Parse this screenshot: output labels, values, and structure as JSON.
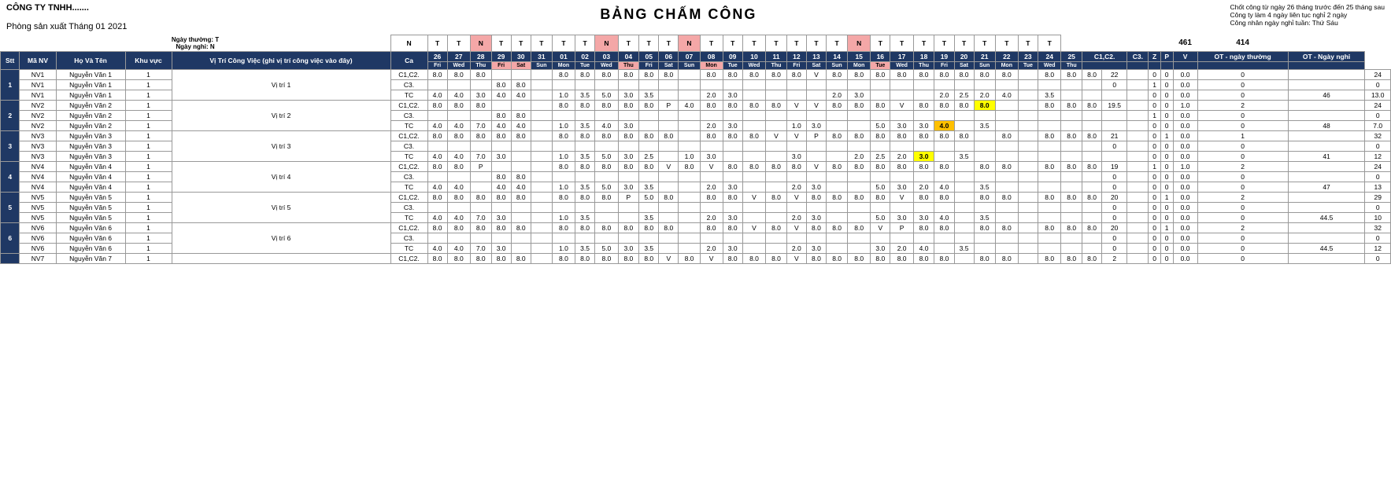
{
  "company": {
    "name": "CÔNG TY TNHH.......",
    "dept": "Phòng sản xuất  Tháng 01 2021",
    "title": "BẢNG CHẤM CÔNG",
    "notes": [
      "Chốt công từ ngày 26 tháng trước đến 25 tháng sau",
      "Công ty làm 4 ngày liên tục nghỉ 2 ngày",
      "Công nhân ngày nghỉ tuần: Thứ Sáu"
    ]
  },
  "table": {
    "totals_header": [
      "461",
      "414"
    ],
    "totals_sub": [
      "OT - ngày thường",
      "OT - Ngày nghỉ"
    ],
    "col_headers": {
      "ngay_thuong": "Ngày thường: T",
      "ngay_nghi": "Ngày nghỉ: N"
    }
  }
}
